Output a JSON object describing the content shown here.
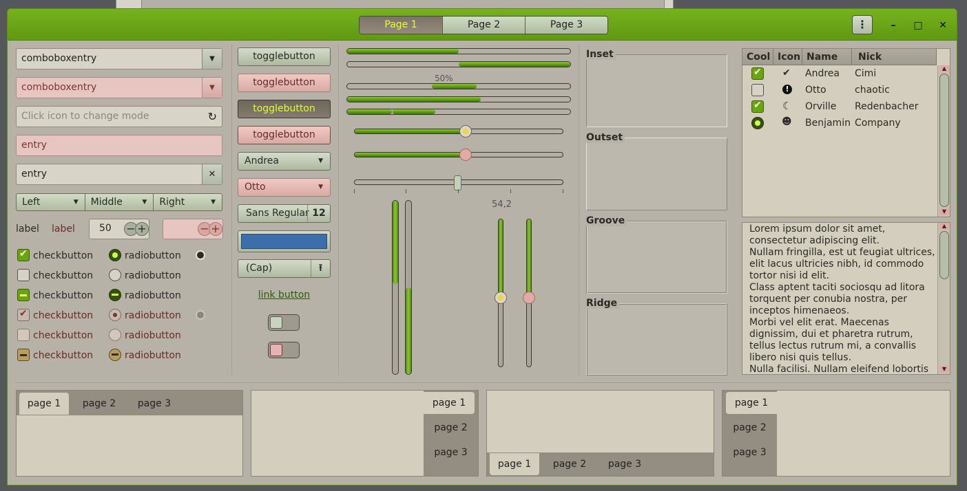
{
  "header": {
    "stack_pages": [
      "Page 1",
      "Page 2",
      "Page 3"
    ],
    "menu_icon": "vertical-ellipsis-icon",
    "window_controls": {
      "minimize": "–",
      "maximize": "□",
      "close": "✕"
    }
  },
  "col1": {
    "combo1": "comboboxentry",
    "combo2": "comboboxentry",
    "search_placeholder": "Click icon to change mode",
    "entry_pink": "entry",
    "entry_clear": "entry",
    "seg": [
      "Left",
      "Middle",
      "Right"
    ],
    "label1": "label",
    "label2": "label",
    "spin_value": "50",
    "checks": [
      "checkbutton",
      "checkbutton",
      "checkbutton",
      "checkbutton",
      "checkbutton",
      "checkbutton"
    ],
    "radios": [
      "radiobutton",
      "radiobutton",
      "radiobutton",
      "radiobutton",
      "radiobutton",
      "radiobutton"
    ]
  },
  "col2": {
    "toggles": [
      "togglebutton",
      "togglebutton",
      "togglebutton",
      "togglebutton"
    ],
    "combo_andrea": "Andrea",
    "combo_otto": "Otto",
    "font_name": "Sans Regular",
    "font_size": "12",
    "color_hex": "#3b6eaa",
    "file_button": "(Cap)",
    "link_button": "link button"
  },
  "col3": {
    "progress_label": "50%",
    "scale_value": "54,2",
    "progress_fractions": [
      0.5,
      0.5,
      0.2,
      0.6
    ],
    "slider_values": [
      0.5,
      0.5,
      0.5
    ]
  },
  "frames": {
    "inset": "Inset",
    "outset": "Outset",
    "groove": "Groove",
    "ridge": "Ridge"
  },
  "tree": {
    "columns": [
      "Cool",
      "Icon",
      "Name",
      "Nick"
    ],
    "rows": [
      {
        "cool": "check",
        "icon": "check-circle-icon",
        "name": "Andrea",
        "nick": "Cimi"
      },
      {
        "cool": "empty",
        "icon": "exclamation-circle-icon",
        "name": "Otto",
        "nick": "chaotic"
      },
      {
        "cool": "check",
        "icon": "moon-icon",
        "name": "Orville",
        "nick": "Redenbacher"
      },
      {
        "cool": "radio",
        "icon": "face-icon",
        "name": "Benjamin",
        "nick": "Company"
      }
    ]
  },
  "textview": {
    "lines": [
      "Lorem ipsum dolor sit amet,",
      "consectetur adipiscing elit.",
      "Nullam fringilla, est ut feugiat ultrices,",
      "elit lacus ultricies nibh, id commodo",
      "tortor nisi id elit.",
      "Class aptent taciti sociosqu ad litora",
      "torquent per conubia nostra, per",
      "inceptos himenaeos.",
      "Morbi vel elit erat. Maecenas",
      "dignissim, dui et pharetra rutrum,",
      "tellus lectus rutrum mi, a convallis",
      "libero nisi quis tellus.",
      "Nulla facilisi. Nullam eleifend lobortis"
    ]
  },
  "notebooks": {
    "nb1": [
      "page 1",
      "page 2",
      "page 3"
    ],
    "nb2": [
      "page 1",
      "page 2",
      "page 3"
    ],
    "nb3": [
      "page 1",
      "page 2",
      "page 3"
    ],
    "nb4": [
      "page 1",
      "page 2",
      "page 3"
    ]
  }
}
